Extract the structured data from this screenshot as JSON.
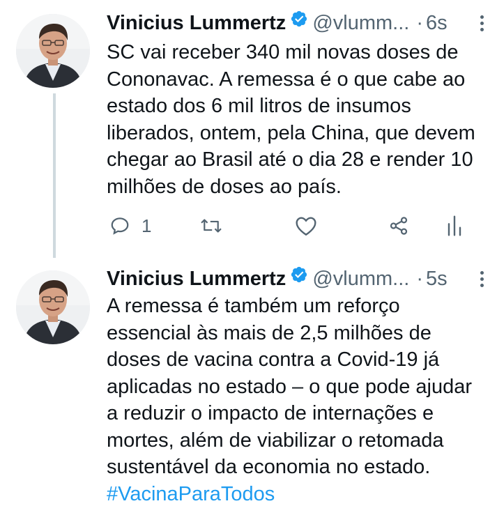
{
  "tweets": [
    {
      "name": "Vinicius Lummertz",
      "handle": "@vlumm...",
      "separator": "·",
      "time": "6s",
      "text": "SC vai receber 340 mil novas doses de Cononavac. A remessa é o que cabe ao estado dos 6 mil litros de insumos liberados, ontem, pela China, que devem chegar ao Brasil até o dia 28 e render 10 milhões de doses ao país.",
      "reply_count": "1"
    },
    {
      "name": "Vinicius Lummertz",
      "handle": "@vlumm...",
      "separator": "·",
      "time": "5s",
      "text": "A remessa é também um reforço essencial às mais de 2,5 milhões de doses de vacina contra a Covid-19 já aplicadas no estado – o que pode ajudar a reduzir o impacto de internações e mortes, além de viabilizar o retomada sustentável da economia no estado.",
      "hashtag": "#VacinaParaTodos"
    }
  ],
  "colors": {
    "text": "#0f1419",
    "secondary": "#536471",
    "accent": "#1d9bf0",
    "thread_line": "#cfd9de"
  },
  "icons": [
    "verified-badge-icon",
    "more-options-icon",
    "reply-icon",
    "retweet-icon",
    "like-icon",
    "share-icon",
    "analytics-icon"
  ]
}
